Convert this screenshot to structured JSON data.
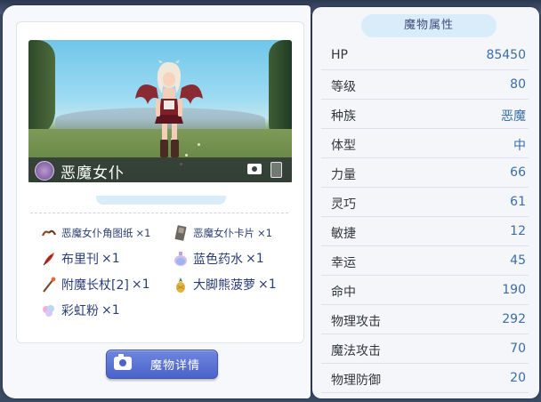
{
  "monster": {
    "name": "恶魔女仆",
    "detail_button": "魔物详情"
  },
  "drops": [
    {
      "name": "恶魔女仆角图纸",
      "count": "×1",
      "icon": "horn-blueprint-icon"
    },
    {
      "name": "恶魔女仆卡片",
      "count": "×1",
      "icon": "card-icon"
    },
    {
      "name": "布里刊",
      "count": "×1",
      "icon": "feather-icon"
    },
    {
      "name": "蓝色药水",
      "count": "×1",
      "icon": "blue-potion-icon"
    },
    {
      "name": "附魔长杖[2]",
      "count": "×1",
      "icon": "staff-icon"
    },
    {
      "name": "大脚熊菠萝",
      "count": "×1",
      "icon": "pineapple-icon"
    },
    {
      "name": "彩虹粉",
      "count": "×1",
      "icon": "rainbow-powder-icon"
    }
  ],
  "stats": {
    "title": "魔物属性",
    "rows": [
      {
        "label": "HP",
        "value": "85450"
      },
      {
        "label": "等级",
        "value": "80"
      },
      {
        "label": "种族",
        "value": "恶魔"
      },
      {
        "label": "体型",
        "value": "中"
      },
      {
        "label": "力量",
        "value": "66"
      },
      {
        "label": "灵巧",
        "value": "61"
      },
      {
        "label": "敏捷",
        "value": "12"
      },
      {
        "label": "幸运",
        "value": "45"
      },
      {
        "label": "命中",
        "value": "190"
      },
      {
        "label": "物理攻击",
        "value": "292"
      },
      {
        "label": "魔法攻击",
        "value": "70"
      },
      {
        "label": "物理防御",
        "value": "20"
      }
    ]
  },
  "colors": {
    "accent": "#4b63c8",
    "value_text": "#3a6ea8",
    "drop_text": "#2b3d75"
  }
}
